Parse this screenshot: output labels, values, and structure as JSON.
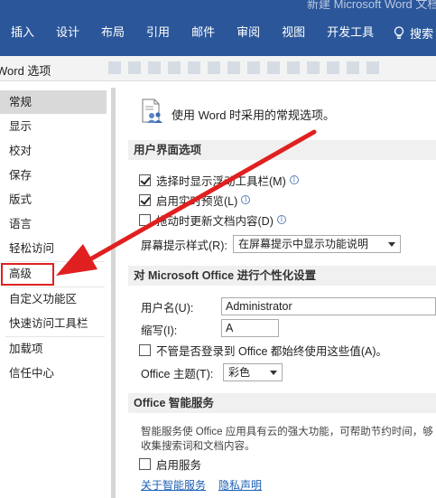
{
  "ribbon": {
    "title": "新建 Microsoft Word 文档",
    "tabs": [
      "插入",
      "设计",
      "布局",
      "引用",
      "邮件",
      "审阅",
      "视图",
      "开发工具"
    ],
    "search_label": "搜索"
  },
  "dialog": {
    "title": "Word 选项"
  },
  "nav": {
    "items": [
      "常规",
      "显示",
      "校对",
      "保存",
      "版式",
      "语言",
      "轻松访问",
      "高级",
      "自定义功能区",
      "快速访问工具栏",
      "加载项",
      "信任中心"
    ],
    "selected": "常规",
    "highlighted": "高级"
  },
  "content": {
    "header": "使用 Word 时采用的常规选项。",
    "ui_section": {
      "title": "用户界面选项",
      "options": [
        {
          "label": "选择时显示浮动工具栏(M)",
          "checked": true
        },
        {
          "label": "启用实时预览(L)",
          "checked": true
        },
        {
          "label": "拖动时更新文档内容(D)",
          "checked": false
        }
      ],
      "screentip_label": "屏幕提示样式(R):",
      "screentip_value": "在屏幕提示中显示功能说明"
    },
    "personalize_section": {
      "title": "对 Microsoft Office 进行个性化设置",
      "username_label": "用户名(U):",
      "username_value": "Administrator",
      "initials_label": "缩写(I):",
      "initials_value": "A",
      "always_use_label": "不管是否登录到 Office 都始终使用这些值(A)。",
      "theme_label": "Office 主题(T):",
      "theme_value": "彩色"
    },
    "intelligent_section": {
      "title": "Office 智能服务",
      "description": "智能服务使 Office 应用具有云的强大功能，可帮助节约时间，够收集搜索词和文档内容。",
      "enable_label": "启用服务",
      "about_link": "关于智能服务",
      "privacy_link": "隐私声明"
    }
  },
  "colors": {
    "ribbon": "#2b579a",
    "selected_nav": "#d9d9d9",
    "annotation": "#e02020",
    "link": "#1a5fb4"
  }
}
